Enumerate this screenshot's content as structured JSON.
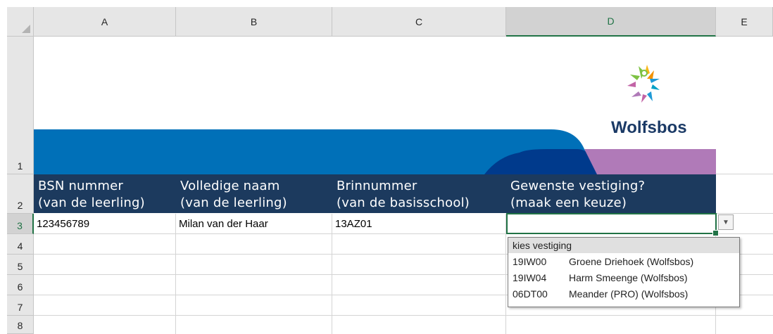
{
  "columns": [
    "A",
    "B",
    "C",
    "D",
    "E"
  ],
  "rows": [
    "1",
    "2",
    "3",
    "4",
    "5",
    "6",
    "7",
    "8"
  ],
  "selected_column": "D",
  "selected_row": "3",
  "brand": {
    "name": "Wolfsbos",
    "colors": {
      "dark_navy": "#1c3a5e",
      "blue": "#0070b8",
      "deep_blue": "#003a8c",
      "purple": "#b07ab8",
      "excel_green": "#217346"
    }
  },
  "headers": [
    {
      "line1": "BSN nummer",
      "line2": "(van de leerling)"
    },
    {
      "line1": "Volledige naam",
      "line2": "(van de leerling)"
    },
    {
      "line1": "Brinnummer",
      "line2": "(van de basisschool)"
    },
    {
      "line1": "Gewenste vestiging?",
      "line2": "(maak een keuze)"
    }
  ],
  "row3": {
    "bsn": "123456789",
    "name": "Milan van der Haar",
    "brin": "13AZ01",
    "vestiging": ""
  },
  "dropdown": {
    "title": "kies vestiging",
    "options": [
      {
        "code": "19IW00",
        "label": "Groene Driehoek (Wolfsbos)"
      },
      {
        "code": "19IW04",
        "label": "Harm Smeenge (Wolfsbos)"
      },
      {
        "code": "06DT00",
        "label": "Meander (PRO) (Wolfsbos)"
      }
    ]
  }
}
